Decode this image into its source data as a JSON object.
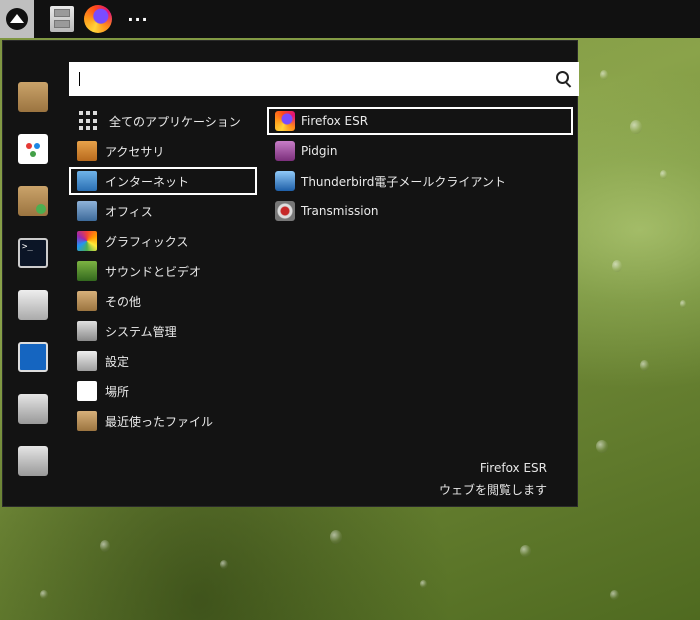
{
  "panel": {
    "menu_icon": "menu-logo-icon",
    "launchers": [
      "file-manager-icon",
      "firefox-icon"
    ],
    "more_label": "···"
  },
  "search": {
    "value": "",
    "icon": "search-icon"
  },
  "sidebar": {
    "items": [
      "package-installer-icon",
      "software-store-icon",
      "package-update-icon",
      "terminal-icon",
      "settings-mixer-icon",
      "lock-screen-icon",
      "logout-icon",
      "power-icon"
    ]
  },
  "categories": [
    {
      "label": "全てのアプリケーション",
      "icon": "all-apps-grid-icon"
    },
    {
      "label": "アクセサリ",
      "icon": "accessories-icon"
    },
    {
      "label": "インターネット",
      "icon": "internet-icon"
    },
    {
      "label": "オフィス",
      "icon": "office-icon"
    },
    {
      "label": "グラフィックス",
      "icon": "graphics-icon"
    },
    {
      "label": "サウンドとビデオ",
      "icon": "sound-video-icon"
    },
    {
      "label": "その他",
      "icon": "other-icon"
    },
    {
      "label": "システム管理",
      "icon": "system-admin-icon"
    },
    {
      "label": "設定",
      "icon": "settings-icon"
    },
    {
      "label": "場所",
      "icon": "places-folder-icon"
    },
    {
      "label": "最近使ったファイル",
      "icon": "recent-files-icon"
    }
  ],
  "selected_category": "インターネット",
  "apps": [
    {
      "label": "Firefox ESR",
      "icon": "firefox-icon"
    },
    {
      "label": "Pidgin",
      "icon": "pidgin-icon"
    },
    {
      "label": "Thunderbird電子メールクライアント",
      "icon": "thunderbird-icon"
    },
    {
      "label": "Transmission",
      "icon": "transmission-icon"
    }
  ],
  "description": {
    "title": "Firefox ESR",
    "subtitle": "ウェブを閲覧します"
  }
}
